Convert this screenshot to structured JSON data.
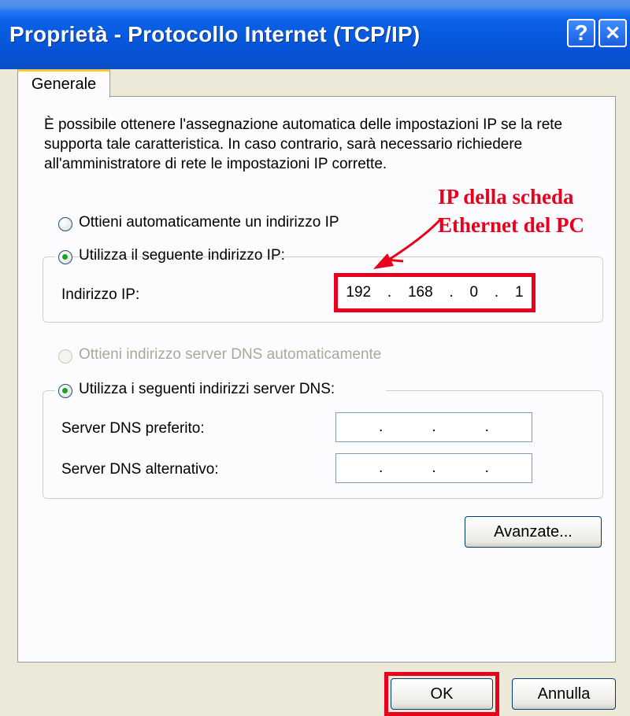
{
  "window": {
    "title": "Proprietà - Protocollo Internet (TCP/IP)",
    "help_glyph": "?",
    "close_glyph": "✕"
  },
  "tabs": [
    {
      "label": "Generale"
    }
  ],
  "description": "È possibile ottenere l'assegnazione automatica delle impostazioni IP se la rete supporta tale caratteristica. In caso contrario, sarà necessario richiedere all'amministratore di rete le impostazioni IP corrette.",
  "ip_section": {
    "auto_label": "Ottieni automaticamente un indirizzo IP",
    "manual_label": "Utilizza il seguente indirizzo IP:",
    "selected": "manual",
    "ip_address_label": "Indirizzo IP:",
    "ip_address": [
      "192",
      "168",
      "0",
      "1"
    ]
  },
  "dns_section": {
    "auto_label": "Ottieni indirizzo server DNS automaticamente",
    "auto_disabled": true,
    "manual_label": "Utilizza i seguenti indirizzi server DNS:",
    "selected": "manual",
    "preferred_label": "Server DNS preferito:",
    "preferred_value": [
      "",
      "",
      "",
      ""
    ],
    "alternate_label": "Server DNS alternativo:",
    "alternate_value": [
      "",
      "",
      "",
      ""
    ]
  },
  "buttons": {
    "advanced": "Avanzate...",
    "ok": "OK",
    "cancel": "Annulla"
  },
  "annotation": {
    "line1": "IP della scheda",
    "line2": "Ethernet del PC",
    "color": "#e8001c"
  },
  "colors": {
    "titlebar": "#0654d7",
    "dialog_bg": "#ece9d8",
    "highlight_red": "#e8001c"
  }
}
